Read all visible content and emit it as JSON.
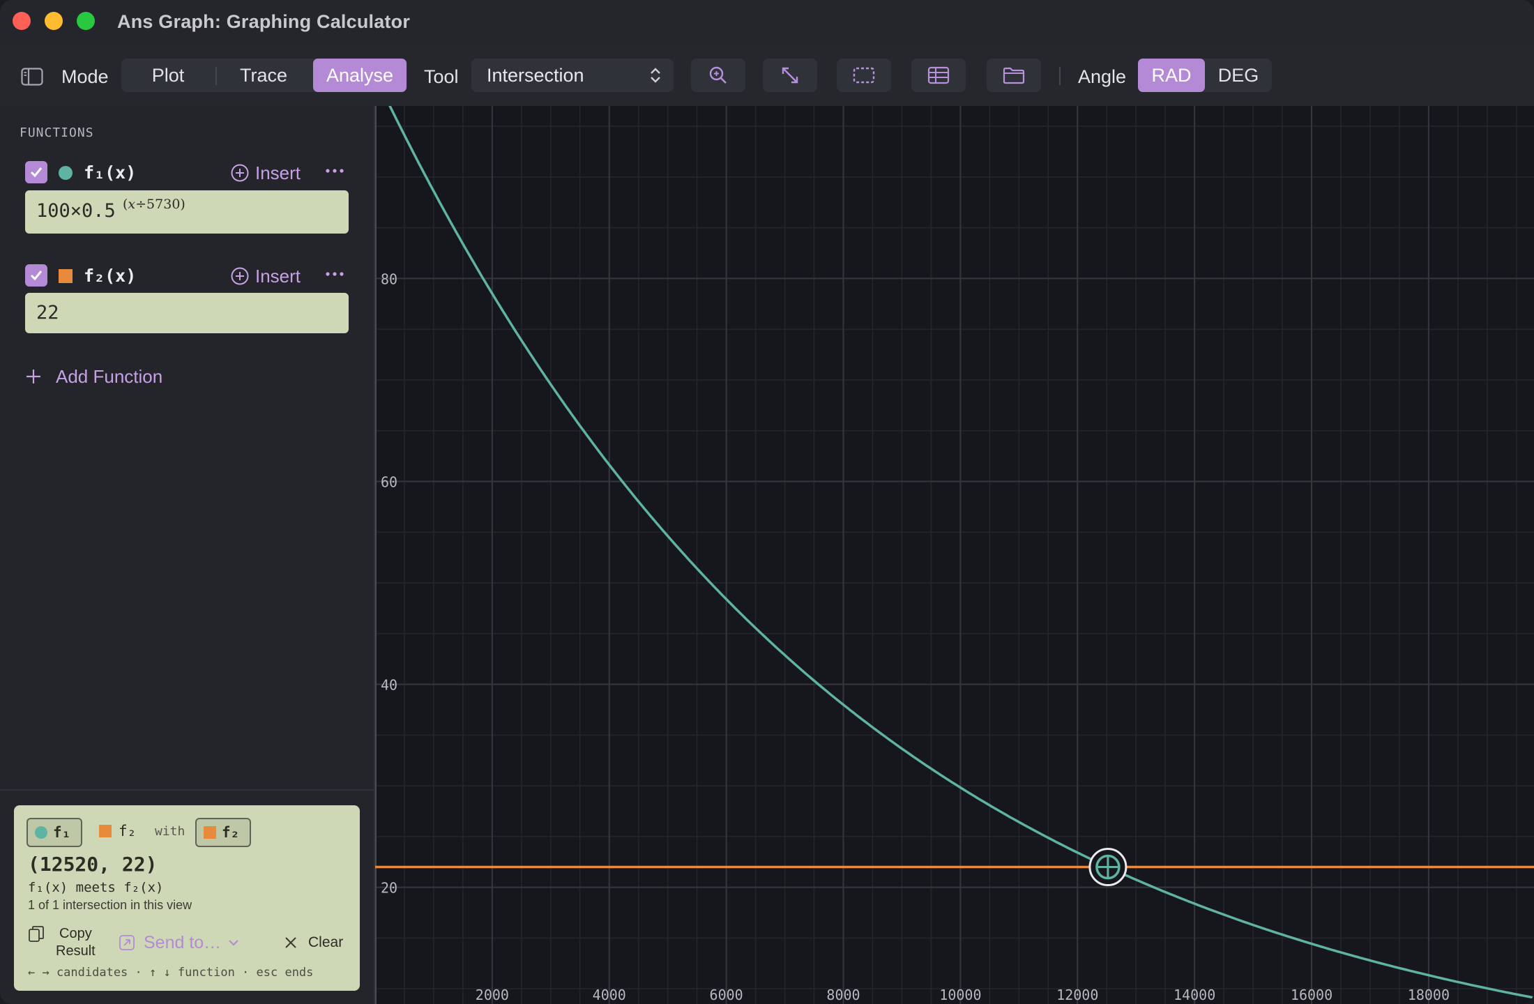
{
  "window": {
    "title": "Ans Graph: Graphing Calculator"
  },
  "toolbar": {
    "mode_label": "Mode",
    "modes": [
      "Plot",
      "Trace",
      "Analyse"
    ],
    "active_mode": "Analyse",
    "tool_label": "Tool",
    "tool_value": "Intersection",
    "icons": [
      "zoom-icon",
      "fit-expand-icon",
      "selection-rect-icon",
      "table-icon",
      "folder-icon"
    ],
    "angle_label": "Angle",
    "angle_options": [
      "RAD",
      "DEG"
    ],
    "active_angle": "RAD"
  },
  "sidebar": {
    "section_title": "FUNCTIONS",
    "functions": [
      {
        "name": "f₁(x)",
        "color": "#5fb3a3",
        "marker": "circle",
        "enabled": true,
        "expr_base": "100×0.5",
        "expr_exp": "(𝑥÷5730)",
        "insert_label": "Insert"
      },
      {
        "name": "f₂(x)",
        "color": "#e78a3c",
        "marker": "square",
        "enabled": true,
        "expr_base": "22",
        "expr_exp": "",
        "insert_label": "Insert"
      }
    ],
    "add_function_label": "Add Function"
  },
  "result": {
    "chip_1": "f₁",
    "chip_2": "f₂",
    "with_label": "with",
    "chip_3": "f₂",
    "coordinates": "(12520, 22)",
    "meets_text": "f₁(x) meets f₂(x)",
    "count_text": "1 of 1 intersection in this view",
    "copy_label_1": "Copy",
    "copy_label_2": "Result",
    "send_label": "Send to…",
    "clear_label": "Clear",
    "hint": "← → candidates · ↑ ↓ function · esc ends"
  },
  "chart_data": {
    "type": "line",
    "xlim": [
      0,
      19800
    ],
    "ylim": [
      8.5,
      97
    ],
    "x_ticks": [
      2000,
      4000,
      6000,
      8000,
      10000,
      12000,
      14000,
      16000,
      18000
    ],
    "y_ticks": [
      20,
      40,
      60,
      80
    ],
    "grid": true,
    "series": [
      {
        "name": "f₁(x)",
        "expression": "100×0.5^(x÷5730)",
        "color": "#5fb3a3"
      },
      {
        "name": "f₂(x)",
        "expression": "22",
        "color": "#e78a3c"
      }
    ],
    "intersection": {
      "x": 12520,
      "y": 22
    }
  }
}
